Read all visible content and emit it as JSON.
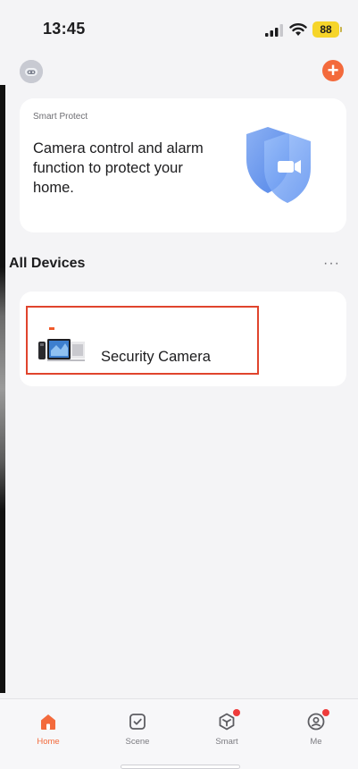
{
  "status_bar": {
    "time": "13:45",
    "battery": "88"
  },
  "header": {
    "avatar_icon": "robot-avatar-icon",
    "add_icon": "plus-icon",
    "add_symbol": "+"
  },
  "smart_protect": {
    "label": "Smart Protect",
    "text": "Camera control and alarm function to protect your home.",
    "icon": "shield-camera-icon"
  },
  "devices": {
    "title": "All Devices",
    "more": "···",
    "items": [
      {
        "name": "Security Camera",
        "icon": "camera-device-thumbnail"
      }
    ]
  },
  "tab_bar": {
    "tabs": [
      {
        "label": "Home",
        "icon": "home-icon",
        "active": true
      },
      {
        "label": "Scene",
        "icon": "scene-check-icon",
        "active": false
      },
      {
        "label": "Smart",
        "icon": "smart-cube-icon",
        "active": false,
        "badge": true
      },
      {
        "label": "Me",
        "icon": "profile-icon",
        "active": false,
        "badge": true
      }
    ]
  },
  "colors": {
    "accent": "#f36a3c",
    "highlight": "#e0442d",
    "battery": "#f6d52a",
    "badge": "#ee3b3b"
  }
}
